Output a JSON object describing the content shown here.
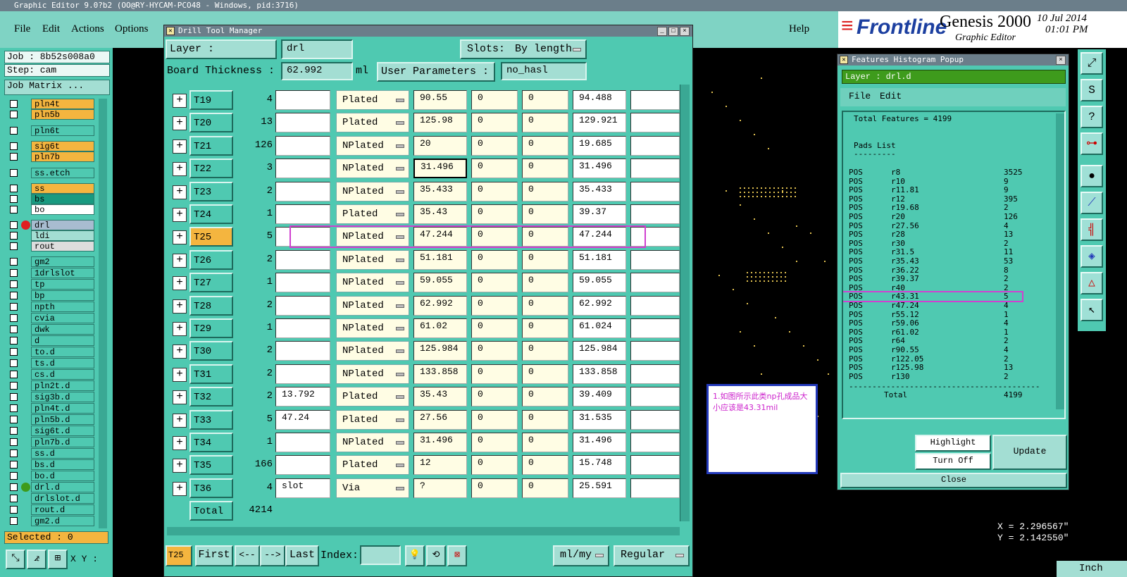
{
  "app": {
    "window_title": "Graphic Editor 9.0?b2 (OO@RY-HYCAM-PCO48 - Windows, pid:3716)",
    "menus": [
      "File",
      "Edit",
      "Actions",
      "Options"
    ],
    "help": "Help",
    "brand": "Frontline",
    "product": "Genesis 2000",
    "product_sub": "Graphic Editor",
    "date": "10 Jul 2014",
    "time": "01:01 PM"
  },
  "left": {
    "job": "Job : 8b52s008a0",
    "step": "Step: cam",
    "job_matrix": "Job Matrix ...",
    "layers": [
      {
        "name": "pln4t",
        "color": "#f4b53f"
      },
      {
        "name": "pln5b",
        "color": "#f4b53f"
      },
      {
        "name": "pln6t",
        "color": "#4fc9b1"
      },
      {
        "name": "sig6t",
        "color": "#f4b53f"
      },
      {
        "name": "pln7b",
        "color": "#f4b53f"
      },
      {
        "name": "ss.etch",
        "color": "#4fc9b1"
      },
      {
        "name": "ss",
        "color": "#f4b53f"
      },
      {
        "name": "bs",
        "color": "#189a80"
      },
      {
        "name": "bo",
        "color": "#ffffff"
      },
      {
        "name": "drl",
        "color": "#a8bcd0"
      },
      {
        "name": "ldi",
        "color": "#a3ded3"
      },
      {
        "name": "rout",
        "color": "#dddddd"
      },
      {
        "name": "gm2",
        "color": "#4fc9b1"
      },
      {
        "name": "1drlslot",
        "color": "#4fc9b1"
      },
      {
        "name": "tp",
        "color": "#4fc9b1"
      },
      {
        "name": "bp",
        "color": "#4fc9b1"
      },
      {
        "name": "npth",
        "color": "#4fc9b1"
      },
      {
        "name": "cvia",
        "color": "#4fc9b1"
      },
      {
        "name": "dwk",
        "color": "#4fc9b1"
      },
      {
        "name": "d",
        "color": "#4fc9b1"
      },
      {
        "name": "to.d",
        "color": "#4fc9b1"
      },
      {
        "name": "ts.d",
        "color": "#4fc9b1"
      },
      {
        "name": "cs.d",
        "color": "#4fc9b1"
      },
      {
        "name": "pln2t.d",
        "color": "#4fc9b1"
      },
      {
        "name": "sig3b.d",
        "color": "#4fc9b1"
      },
      {
        "name": "pln4t.d",
        "color": "#4fc9b1"
      },
      {
        "name": "pln5b.d",
        "color": "#4fc9b1"
      },
      {
        "name": "sig6t.d",
        "color": "#4fc9b1"
      },
      {
        "name": "pln7b.d",
        "color": "#4fc9b1"
      },
      {
        "name": "ss.d",
        "color": "#4fc9b1"
      },
      {
        "name": "bs.d",
        "color": "#4fc9b1"
      },
      {
        "name": "bo.d",
        "color": "#4fc9b1"
      },
      {
        "name": "drl.d",
        "color": "#4fc9b1"
      },
      {
        "name": "drlslot.d",
        "color": "#4fc9b1"
      },
      {
        "name": "rout.d",
        "color": "#4fc9b1"
      },
      {
        "name": "gm2.d",
        "color": "#4fc9b1"
      }
    ],
    "selected": "Selected : 0",
    "xy_label": "X Y :"
  },
  "dtm": {
    "title": "Drill Tool Manager",
    "layer_label": "Layer :",
    "layer_value": "drl",
    "slots_label": "Slots:",
    "slots_value": "By length",
    "thickness_label": "Board Thickness :",
    "thickness_value": "62.992",
    "thickness_unit": "ml",
    "user_params_label": "User Parameters :",
    "user_params_value": "no_hasl",
    "rows": [
      {
        "tool": "T19",
        "count": "4",
        "c1": "",
        "type": "Plated",
        "size": "90.55",
        "a": "0",
        "b": "0",
        "fin": "94.488"
      },
      {
        "tool": "T20",
        "count": "13",
        "c1": "",
        "type": "Plated",
        "size": "125.98",
        "a": "0",
        "b": "0",
        "fin": "129.921"
      },
      {
        "tool": "T21",
        "count": "126",
        "c1": "",
        "type": "NPlated",
        "size": "20",
        "a": "0",
        "b": "0",
        "fin": "19.685"
      },
      {
        "tool": "T22",
        "count": "3",
        "c1": "",
        "type": "NPlated",
        "size": "31.496",
        "a": "0",
        "b": "0",
        "fin": "31.496"
      },
      {
        "tool": "T23",
        "count": "2",
        "c1": "",
        "type": "NPlated",
        "size": "35.433",
        "a": "0",
        "b": "0",
        "fin": "35.433"
      },
      {
        "tool": "T24",
        "count": "1",
        "c1": "",
        "type": "Plated",
        "size": "35.43",
        "a": "0",
        "b": "0",
        "fin": "39.37"
      },
      {
        "tool": "T25",
        "count": "5",
        "c1": "",
        "type": "NPlated",
        "size": "47.244",
        "a": "0",
        "b": "0",
        "fin": "47.244"
      },
      {
        "tool": "T26",
        "count": "2",
        "c1": "",
        "type": "NPlated",
        "size": "51.181",
        "a": "0",
        "b": "0",
        "fin": "51.181"
      },
      {
        "tool": "T27",
        "count": "1",
        "c1": "",
        "type": "NPlated",
        "size": "59.055",
        "a": "0",
        "b": "0",
        "fin": "59.055"
      },
      {
        "tool": "T28",
        "count": "2",
        "c1": "",
        "type": "NPlated",
        "size": "62.992",
        "a": "0",
        "b": "0",
        "fin": "62.992"
      },
      {
        "tool": "T29",
        "count": "1",
        "c1": "",
        "type": "NPlated",
        "size": "61.02",
        "a": "0",
        "b": "0",
        "fin": "61.024"
      },
      {
        "tool": "T30",
        "count": "2",
        "c1": "",
        "type": "NPlated",
        "size": "125.984",
        "a": "0",
        "b": "0",
        "fin": "125.984"
      },
      {
        "tool": "T31",
        "count": "2",
        "c1": "",
        "type": "NPlated",
        "size": "133.858",
        "a": "0",
        "b": "0",
        "fin": "133.858"
      },
      {
        "tool": "T32",
        "count": "2",
        "c1": "13.792",
        "type": "Plated",
        "size": "35.43",
        "a": "0",
        "b": "0",
        "fin": "39.409"
      },
      {
        "tool": "T33",
        "count": "5",
        "c1": "47.24",
        "type": "Plated",
        "size": "27.56",
        "a": "0",
        "b": "0",
        "fin": "31.535"
      },
      {
        "tool": "T34",
        "count": "1",
        "c1": "",
        "type": "NPlated",
        "size": "31.496",
        "a": "0",
        "b": "0",
        "fin": "31.496"
      },
      {
        "tool": "T35",
        "count": "166",
        "c1": "",
        "type": "Plated",
        "size": "12",
        "a": "0",
        "b": "0",
        "fin": "15.748"
      },
      {
        "tool": "T36",
        "count": "4",
        "c1": "slot",
        "type": "Via",
        "size": "?",
        "a": "0",
        "b": "0",
        "fin": "25.591"
      }
    ],
    "total_label": "Total",
    "total_value": "4214",
    "current_tool": "T25",
    "first": "First",
    "prev": "<--",
    "next": "-->",
    "last": "Last",
    "index_label": "Index:",
    "units": "ml/my",
    "mode": "Regular"
  },
  "hist": {
    "title": "Features Histogram Popup",
    "layer": "Layer :  drl.d",
    "menus": [
      "File",
      "Edit"
    ],
    "total_features": "Total Features = 4199",
    "pads_list": "Pads List",
    "pads_rule": "---------",
    "rows": [
      {
        "pol": "POS",
        "sym": "r8",
        "cnt": "3525"
      },
      {
        "pol": "POS",
        "sym": "r10",
        "cnt": "9"
      },
      {
        "pol": "POS",
        "sym": "r11.81",
        "cnt": "9"
      },
      {
        "pol": "POS",
        "sym": "r12",
        "cnt": "395"
      },
      {
        "pol": "POS",
        "sym": "r19.68",
        "cnt": "2"
      },
      {
        "pol": "POS",
        "sym": "r20",
        "cnt": "126"
      },
      {
        "pol": "POS",
        "sym": "r27.56",
        "cnt": "4"
      },
      {
        "pol": "POS",
        "sym": "r28",
        "cnt": "13"
      },
      {
        "pol": "POS",
        "sym": "r30",
        "cnt": "2"
      },
      {
        "pol": "POS",
        "sym": "r31.5",
        "cnt": "11"
      },
      {
        "pol": "POS",
        "sym": "r35.43",
        "cnt": "53"
      },
      {
        "pol": "POS",
        "sym": "r36.22",
        "cnt": "8"
      },
      {
        "pol": "POS",
        "sym": "r39.37",
        "cnt": "2"
      },
      {
        "pol": "POS",
        "sym": "r40",
        "cnt": "2"
      },
      {
        "pol": "POS",
        "sym": "r43.31",
        "cnt": "5"
      },
      {
        "pol": "POS",
        "sym": "r47.24",
        "cnt": "4"
      },
      {
        "pol": "POS",
        "sym": "r55.12",
        "cnt": "1"
      },
      {
        "pol": "POS",
        "sym": "r59.06",
        "cnt": "4"
      },
      {
        "pol": "POS",
        "sym": "r61.02",
        "cnt": "1"
      },
      {
        "pol": "POS",
        "sym": "r64",
        "cnt": "2"
      },
      {
        "pol": "POS",
        "sym": "r90.55",
        "cnt": "4"
      },
      {
        "pol": "POS",
        "sym": "r122.05",
        "cnt": "2"
      },
      {
        "pol": "POS",
        "sym": "r125.98",
        "cnt": "13"
      },
      {
        "pol": "POS",
        "sym": "r130",
        "cnt": "2"
      }
    ],
    "rule": "-----------------------------------------",
    "total_label": "Total",
    "total_value": "4199",
    "highlight": "Highlight",
    "turn_off": "Turn Off",
    "update": "Update",
    "close": "Close"
  },
  "note": {
    "text": "1.如图所示此类np孔成品大小应该是43.31mil"
  },
  "coords": {
    "x": "X = 2.296567\"",
    "y": "Y = 2.142550\"",
    "unit": "Inch"
  }
}
